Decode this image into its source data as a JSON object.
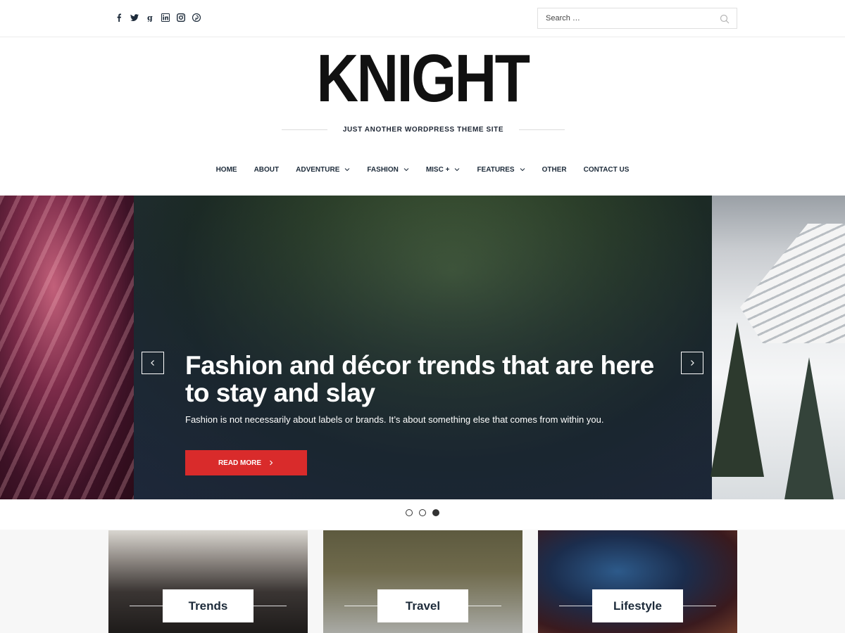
{
  "header": {
    "social_icons": [
      "facebook-icon",
      "twitter-icon",
      "google-plus-icon",
      "linkedin-icon",
      "instagram-icon",
      "pinterest-icon"
    ],
    "search": {
      "placeholder": "Search …"
    }
  },
  "site": {
    "title": "KNIGHT",
    "tagline": "JUST ANOTHER WORDPRESS THEME SITE"
  },
  "nav": {
    "items": [
      {
        "label": "HOME",
        "has_dropdown": false
      },
      {
        "label": "ABOUT",
        "has_dropdown": false
      },
      {
        "label": "ADVENTURE",
        "has_dropdown": true
      },
      {
        "label": "FASHION",
        "has_dropdown": true
      },
      {
        "label": "MISC +",
        "has_dropdown": true
      },
      {
        "label": "FEATURES",
        "has_dropdown": true
      },
      {
        "label": "OTHER",
        "has_dropdown": false
      },
      {
        "label": "CONTACT US",
        "has_dropdown": false
      }
    ]
  },
  "slider": {
    "title": "Fashion and décor trends that are here to stay and slay",
    "excerpt": "Fashion is not necessarily about labels or brands. It’s about something else that comes from within you.",
    "button_label": "READ MORE",
    "dots": 3,
    "active_dot": 3
  },
  "categories": [
    {
      "label": "Trends"
    },
    {
      "label": "Travel"
    },
    {
      "label": "Lifestyle"
    }
  ],
  "colors": {
    "accent": "#d92b2b",
    "text_dark": "#1d2b3a"
  }
}
